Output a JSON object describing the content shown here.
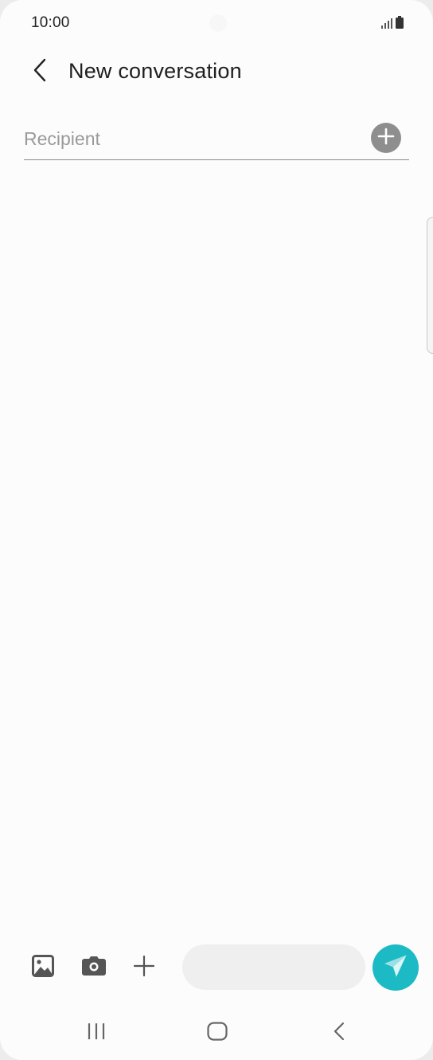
{
  "status_bar": {
    "time": "10:00",
    "icons": [
      "signal-icon",
      "battery-icon"
    ]
  },
  "header": {
    "back_icon": "chevron-left-icon",
    "title": "New conversation"
  },
  "recipient": {
    "placeholder": "Recipient",
    "value": "",
    "add_icon": "add-circle-icon"
  },
  "compose_bar": {
    "icons": [
      "gallery-icon",
      "camera-icon",
      "plus-icon"
    ],
    "message_value": "",
    "send_icon": "send-icon"
  },
  "nav_bar": {
    "icons": [
      "recent-apps-icon",
      "home-icon",
      "back-icon"
    ]
  },
  "colors": {
    "accent": "#1bbac4",
    "background": "#fcfcfc",
    "add_button": "#8e8e8e"
  }
}
